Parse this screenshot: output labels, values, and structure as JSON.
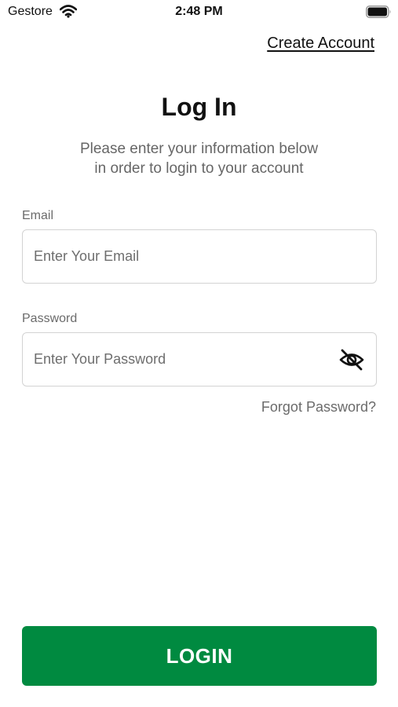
{
  "status_bar": {
    "carrier": "Gestore",
    "time": "2:48 PM",
    "icons": [
      "wifi-icon",
      "battery-icon"
    ]
  },
  "header": {
    "create_account_label": "Create Account"
  },
  "main": {
    "title": "Log In",
    "subtitle_line1": "Please enter your information below",
    "subtitle_line2": "in order to login to your account"
  },
  "form": {
    "email": {
      "label": "Email",
      "placeholder": "Enter Your Email",
      "value": ""
    },
    "password": {
      "label": "Password",
      "placeholder": "Enter Your Password",
      "value": "",
      "toggle_icon": "eye-off-icon"
    },
    "forgot_label": "Forgot Password?",
    "login_label": "LOGIN"
  },
  "colors": {
    "primary": "#008a40",
    "text": "#111111",
    "muted": "#6b6b6b",
    "border": "#d3d3d3"
  }
}
